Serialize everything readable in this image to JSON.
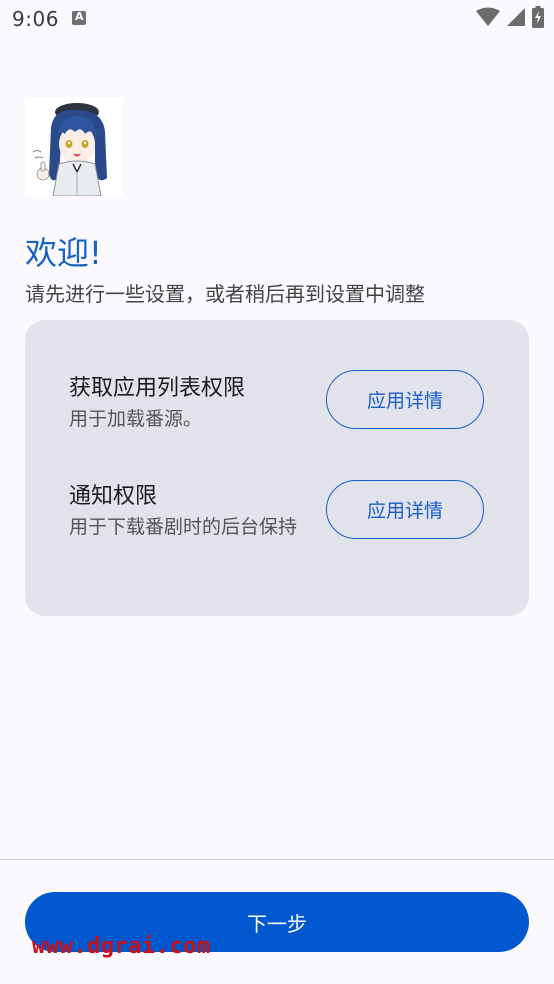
{
  "status_bar": {
    "time": "9:06",
    "icons": [
      "text-notification-icon",
      "wifi-icon",
      "cellular-signal-icon",
      "battery-charging-icon"
    ]
  },
  "welcome": {
    "title": "欢迎!",
    "subtitle": "请先进行一些设置，或者稍后再到设置中调整"
  },
  "permissions": [
    {
      "title": "获取应用列表权限",
      "description": "用于加载番源。",
      "button": "应用详情"
    },
    {
      "title": "通知权限",
      "description": "用于下载番剧时的后台保持",
      "button": "应用详情"
    }
  ],
  "footer": {
    "next_label": "下一步"
  },
  "watermark": "www.dgrai.com",
  "colors": {
    "accent": "#0057ce",
    "title": "#1565c0",
    "card": "#e1e2ea",
    "background": "#fbf9fe",
    "watermark": "#c8101a"
  }
}
